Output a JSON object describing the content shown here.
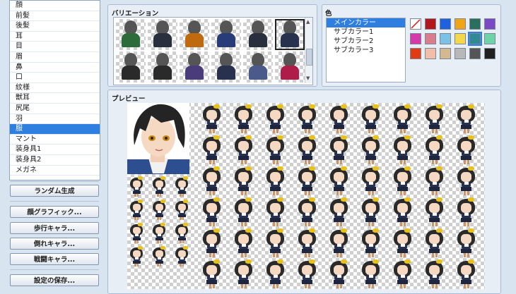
{
  "parts_list": {
    "items": [
      "顔",
      "前髪",
      "後髪",
      "耳",
      "目",
      "眉",
      "鼻",
      "口",
      "紋様",
      "獣耳",
      "尻尾",
      "羽",
      "服",
      "マント",
      "装身具1",
      "装身具2",
      "メガネ"
    ],
    "selected_index": 12
  },
  "left_buttons": {
    "random": "ランダム生成",
    "face_graphic": "顔グラフィック...",
    "walk_char": "歩行キャラ...",
    "down_char": "倒れキャラ...",
    "battle_char": "戦闘キャラ...",
    "save_settings": "設定の保存..."
  },
  "variation": {
    "title": "バリエーション",
    "selected_index": 5,
    "colors": [
      "#2d6b3a",
      "#2a2f3e",
      "#c06a10",
      "#283c7a",
      "#2a2f3e",
      "#28324f",
      "#2a2a2a",
      "#2a2a2a",
      "#4a3c7a",
      "#28324f",
      "#4a5a8a",
      "#b01c4a"
    ]
  },
  "color": {
    "title": "色",
    "items": [
      "メインカラー",
      "サブカラー1",
      "サブカラー2",
      "サブカラー3"
    ],
    "selected_index": 0,
    "swatches": [
      "none",
      "#b3161c",
      "#1f62e0",
      "#f0a418",
      "#2a6e5e",
      "#7a4ac4",
      "#d63aa8",
      "#d97c8c",
      "#7cc2e6",
      "#f2d84a",
      "#2f8a93",
      "#6ed3a8",
      "#e23a12",
      "#f1bfa8",
      "#d4b890",
      "#b8b8b8",
      "#555555",
      "#202020"
    ],
    "selected_swatch": 10
  },
  "preview": {
    "title": "プレビュー"
  }
}
